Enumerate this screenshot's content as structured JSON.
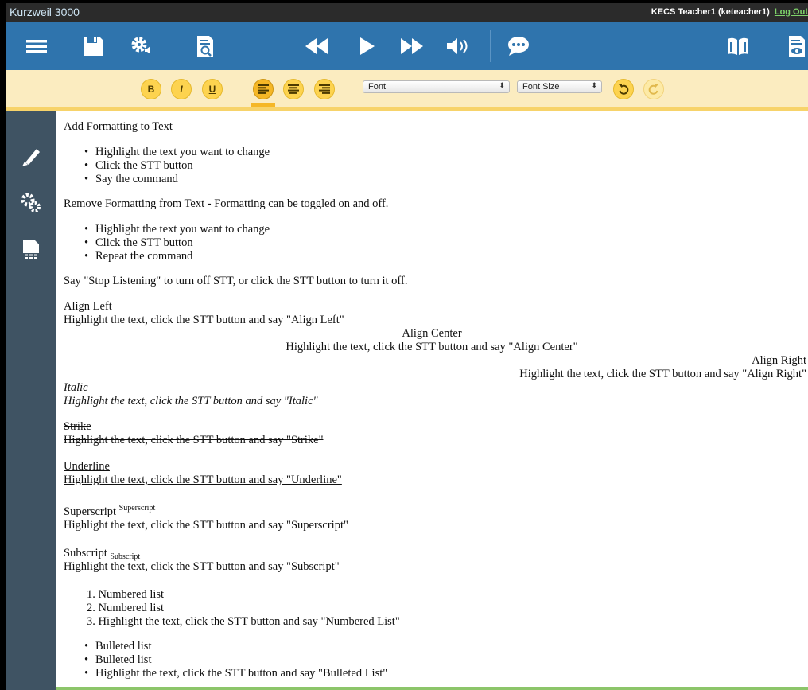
{
  "app": {
    "title": "Kurzweil 3000",
    "user": "KECS Teacher1 (keteacher1)",
    "logout": "Log Out"
  },
  "toolbar": {
    "icons": [
      "menu-icon",
      "save-icon",
      "settings-audio-icon",
      "document-search-icon",
      "rewind-icon",
      "play-icon",
      "fast-forward-icon",
      "volume-icon",
      "speech-bubble-icon",
      "book-icon",
      "document-view-icon"
    ]
  },
  "format": {
    "bold": "B",
    "italic": "I",
    "underline": "U",
    "font_select": "Font",
    "size_select": "Font Size",
    "active_alignment": "left"
  },
  "sidebar": {
    "icons": [
      "pen-icon",
      "tools-icon",
      "table-document-icon"
    ]
  },
  "doc": {
    "l1": "Add Formatting to Text",
    "b1": [
      "Highlight the text you want to change",
      "Click the STT button",
      "Say the command"
    ],
    "l2": "Remove Formatting from Text - Formatting can be toggled on and off.",
    "b2": [
      "Highlight the text you want to change",
      "Click the STT button",
      "Repeat the command"
    ],
    "l3": "Say \"Stop Listening\" to turn off STT, or click the STT button to turn it off.",
    "align_left_title": "Align Left",
    "align_left_text": "Highlight the text, click the STT button and say \"Align Left\"",
    "align_center_title": "Align Center",
    "align_center_text": "Highlight the text, click the STT button and say \"Align Center\"",
    "align_right_title": "Align Right",
    "align_right_text": "Highlight the text, click the STT button and say \"Align Right\"",
    "italic_title": "Italic",
    "italic_text": "Highlight the text, click the STT button and say \"Italic\"",
    "strike_title": "Strike",
    "strike_text": "Highlight the text, click the STT button and say \"Strike\"",
    "underline_title": "Underline",
    "underline_text": "Highlight the text, click the STT button and say \"Underline\"",
    "superscript_title": "Superscript",
    "superscript_mark": "Superscript",
    "superscript_text": "Highlight the text, click the STT button and say \"Superscript\"",
    "subscript_title": "Subscript",
    "subscript_mark": "Subscript",
    "subscript_text": "Highlight the text, click the STT button and say \"Subscript\"",
    "numbered": [
      "1. Numbered list",
      "2. Numbered list",
      "3. Highlight the text, click the STT button and say \"Numbered List\""
    ],
    "bulleted": [
      "Bulleted list",
      "Bulleted list",
      "Highlight the text, click the STT button and say \"Bulleted List\""
    ]
  },
  "colors": {
    "toolbar": "#2f74ad",
    "format_bar": "#fbecc0",
    "button_yellow": "#fdd34f",
    "sidebar": "#3f5363"
  }
}
